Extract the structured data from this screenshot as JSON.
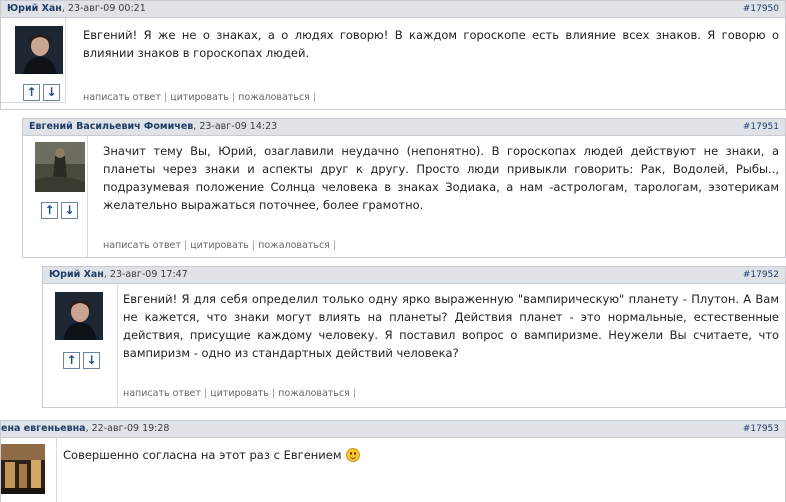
{
  "posts": [
    {
      "author": "Юрий Хан",
      "date": ", 23-авг-09 00:21",
      "number": "#17950",
      "text": "Евгений! Я же не о знаках, а о людях говорю! В каждом гороскопе есть влияние всех знаков. Я говорю о влиянии знаков в гороскопах людей."
    },
    {
      "author": "Евгений Васильевич Фомичев",
      "date": ", 23-авг-09 14:23",
      "number": "#17951",
      "text": "Значит тему Вы, Юрий, озаглавили неудачно (непонятно). В гороскопах людей действуют не знаки, а планеты через знаки и аспекты друг к другу. Просто люди привыкли говорить: Рак, Водолей, Рыбы.., подразумевая положение Солнца человека в знаках Зодиака, а нам -астрологам, тарологам, эзотерикам желательно выражаться поточнее, более грамотно."
    },
    {
      "author": "Юрий Хан",
      "date": ", 23-авг-09 17:47",
      "number": "#17952",
      "text": "Евгений! Я для себя определил только одну ярко выраженную \"вампирическую\" планету - Плутон. А Вам не кажется, что знаки могут влиять на планеты? Действия планет - это нормальные, естественные действия, присущие каждому человеку. Я поставил вопрос о вампиризме. Неужели Вы считаете, что вампиризм - одно из стандартных действий человека?"
    },
    {
      "author": "ена евгеньевна",
      "date": ", 22-авг-09 19:28",
      "number": "#17953",
      "text": "Совершенно согласна на этот раз с Евгением"
    }
  ],
  "actions": {
    "reply": "написать ответ",
    "quote": "цитировать",
    "report": "пожаловаться",
    "separator": "|"
  },
  "icons": {
    "vote_up": "↑",
    "vote_down": "↓",
    "smiley": "smiley-icon"
  }
}
